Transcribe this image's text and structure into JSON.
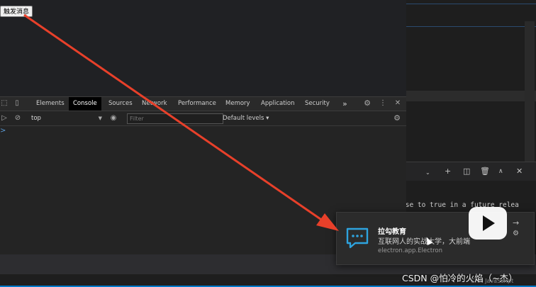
{
  "app": {
    "trigger_button": "触发消息"
  },
  "devtools": {
    "tabs": [
      "Elements",
      "Console",
      "Sources",
      "Network",
      "Performance",
      "Memory",
      "Application",
      "Security"
    ],
    "active_tab": "Console",
    "more_tabs": "»",
    "context": "top",
    "filter_placeholder": "Filter",
    "levels": "Default levels ▾",
    "prompt": ">"
  },
  "terminal": {
    "text": "lse to true in a future relea"
  },
  "notification": {
    "title": "拉勾教育",
    "body": "互联网人的实战大学，大前端",
    "source": "electron.app.Electron",
    "dismiss_icon": "→",
    "settings_icon": "⚙"
  },
  "watermark": {
    "text": "CSDN @怕冷的火焰（~杰）",
    "faint": "CHN  JavaScript"
  },
  "colors": {
    "arrow": "#e8402a",
    "accent": "#007acc",
    "toast_icon": "#2ea3de"
  }
}
